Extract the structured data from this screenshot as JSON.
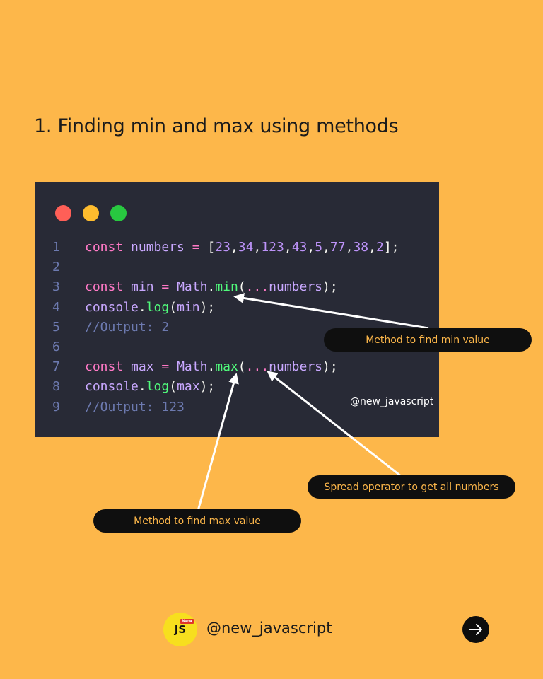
{
  "title": "1. Finding min and max using methods",
  "colors": {
    "background": "#FDB74A",
    "code_background": "#282A36",
    "dot_red": "#FF5F57",
    "dot_yellow": "#FEBC2E",
    "dot_green": "#28C840",
    "callout_text": "#FDB74A"
  },
  "code_lines": [
    {
      "n": "1",
      "tokens": [
        [
          "const ",
          "t-kw"
        ],
        [
          "numbers ",
          "t-plain"
        ],
        [
          "= ",
          "t-kw"
        ],
        [
          "[",
          "t-pun"
        ],
        [
          "23",
          "t-num"
        ],
        [
          ",",
          "t-pun"
        ],
        [
          "34",
          "t-num"
        ],
        [
          ",",
          "t-pun"
        ],
        [
          "123",
          "t-num"
        ],
        [
          ",",
          "t-pun"
        ],
        [
          "43",
          "t-num"
        ],
        [
          ",",
          "t-pun"
        ],
        [
          "5",
          "t-num"
        ],
        [
          ",",
          "t-pun"
        ],
        [
          "77",
          "t-num"
        ],
        [
          ",",
          "t-pun"
        ],
        [
          "38",
          "t-num"
        ],
        [
          ",",
          "t-pun"
        ],
        [
          "2",
          "t-num"
        ],
        [
          "];",
          "t-pun"
        ]
      ]
    },
    {
      "n": "2",
      "tokens": []
    },
    {
      "n": "3",
      "tokens": [
        [
          "const ",
          "t-kw"
        ],
        [
          "min ",
          "t-plain"
        ],
        [
          "= ",
          "t-kw"
        ],
        [
          "Math",
          "t-plain"
        ],
        [
          ".",
          "t-pun"
        ],
        [
          "min",
          "t-fn"
        ],
        [
          "(",
          "t-pun"
        ],
        [
          "...",
          "t-kw"
        ],
        [
          "numbers",
          "t-plain"
        ],
        [
          ");",
          "t-pun"
        ]
      ]
    },
    {
      "n": "4",
      "tokens": [
        [
          "console",
          "t-plain"
        ],
        [
          ".",
          "t-pun"
        ],
        [
          "log",
          "t-fn"
        ],
        [
          "(",
          "t-pun"
        ],
        [
          "min",
          "t-plain"
        ],
        [
          ");",
          "t-pun"
        ]
      ]
    },
    {
      "n": "5",
      "tokens": [
        [
          "//Output: 2",
          "t-cmt"
        ]
      ]
    },
    {
      "n": "6",
      "tokens": []
    },
    {
      "n": "7",
      "tokens": [
        [
          "const ",
          "t-kw"
        ],
        [
          "max ",
          "t-plain"
        ],
        [
          "= ",
          "t-kw"
        ],
        [
          "Math",
          "t-plain"
        ],
        [
          ".",
          "t-pun"
        ],
        [
          "max",
          "t-fn"
        ],
        [
          "(",
          "t-pun"
        ],
        [
          "...",
          "t-kw"
        ],
        [
          "numbers",
          "t-plain"
        ],
        [
          ");",
          "t-pun"
        ]
      ]
    },
    {
      "n": "8",
      "tokens": [
        [
          "console",
          "t-plain"
        ],
        [
          ".",
          "t-pun"
        ],
        [
          "log",
          "t-fn"
        ],
        [
          "(",
          "t-pun"
        ],
        [
          "max",
          "t-plain"
        ],
        [
          ");",
          "t-pun"
        ]
      ]
    },
    {
      "n": "9",
      "tokens": [
        [
          "//Output: 123",
          "t-cmt"
        ]
      ]
    }
  ],
  "watermark_handle": "@new_javascript",
  "callouts": {
    "min_method": "Method to find min value",
    "spread_operator": "Spread operator to get all numbers",
    "max_method": "Method to find max value"
  },
  "footer": {
    "logo_text": "JS",
    "logo_badge": "New",
    "handle": "@new_javascript",
    "next_icon": "arrow-right-icon"
  }
}
